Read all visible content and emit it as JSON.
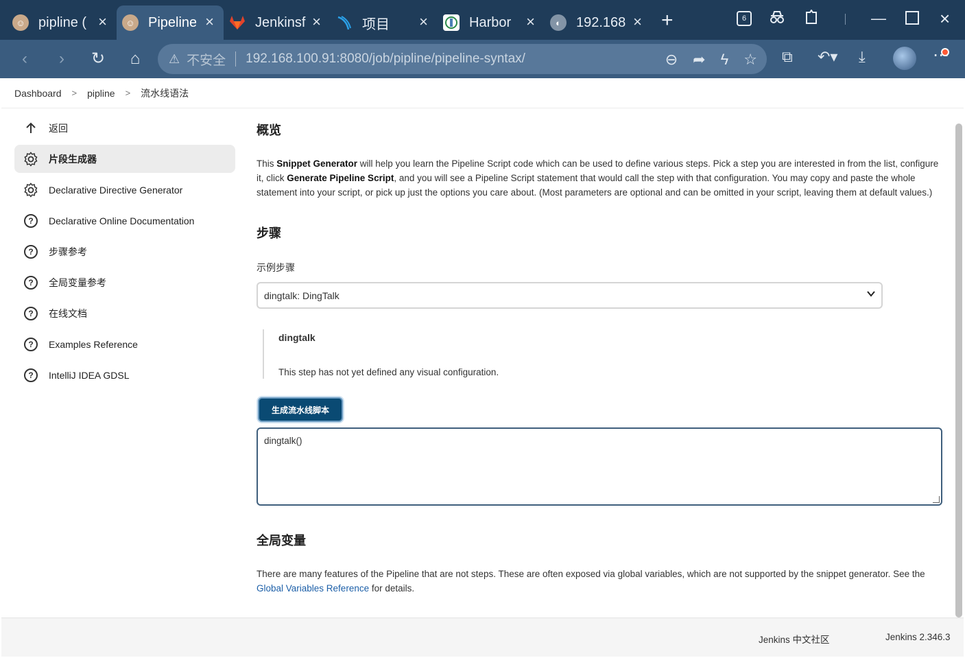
{
  "browser": {
    "tabs": [
      {
        "title": "pipline (",
        "favicon": "jenkins-icon",
        "active": false
      },
      {
        "title": "Pipeline",
        "favicon": "jenkins-icon",
        "active": true
      },
      {
        "title": "Jenkinsf",
        "favicon": "gitlab-icon",
        "active": false
      },
      {
        "title": "项目",
        "favicon": "rancher-icon",
        "active": false
      },
      {
        "title": "Harbor",
        "favicon": "harbor-icon",
        "active": false
      },
      {
        "title": "192.168",
        "favicon": "globe-icon",
        "active": false
      }
    ],
    "tab_counter": "6",
    "insecure_label": "不安全",
    "url": "192.168.100.91:8080/job/pipline/pipeline-syntax/"
  },
  "breadcrumb": {
    "items": [
      "Dashboard",
      "pipline",
      "流水线语法"
    ]
  },
  "sidebar": {
    "items": [
      {
        "label": "返回",
        "icon": "arrow-up-icon"
      },
      {
        "label": "片段生成器",
        "icon": "gear-icon"
      },
      {
        "label": "Declarative Directive Generator",
        "icon": "gear-icon"
      },
      {
        "label": "Declarative Online Documentation",
        "icon": "help-circle-icon"
      },
      {
        "label": "步骤参考",
        "icon": "help-circle-icon"
      },
      {
        "label": "全局变量参考",
        "icon": "help-circle-icon"
      },
      {
        "label": "在线文档",
        "icon": "help-circle-icon"
      },
      {
        "label": "Examples Reference",
        "icon": "help-circle-icon"
      },
      {
        "label": "IntelliJ IDEA GDSL",
        "icon": "help-circle-icon"
      }
    ]
  },
  "main": {
    "overview_title": "概览",
    "overview": {
      "p1": "This ",
      "b1": "Snippet Generator",
      "p2": " will help you learn the Pipeline Script code which can be used to define various steps. Pick a step you are interested in from the list, configure it, click ",
      "b2": "Generate Pipeline Script",
      "p3": ", and you will see a Pipeline Script statement that would call the step with that configuration. You may copy and paste the whole statement into your script, or pick up just the options you care about. (Most parameters are optional and can be omitted in your script, leaving them at default values.)"
    },
    "steps_title": "步骤",
    "sample_step_label": "示例步骤",
    "sample_step_value": "dingtalk: DingTalk",
    "step_name": "dingtalk",
    "step_desc": "This step has not yet defined any visual configuration.",
    "generate_button": "生成流水线脚本",
    "generated_script": "dingtalk()",
    "globals_title": "全局变量",
    "globals": {
      "p1": "There are many features of the Pipeline that are not steps. These are often exposed via global variables, which are not supported by the snippet generator. See the ",
      "link": "Global Variables Reference",
      "p2": " for details."
    }
  },
  "footer": {
    "community": "Jenkins 中文社区",
    "version": "Jenkins 2.346.3"
  }
}
